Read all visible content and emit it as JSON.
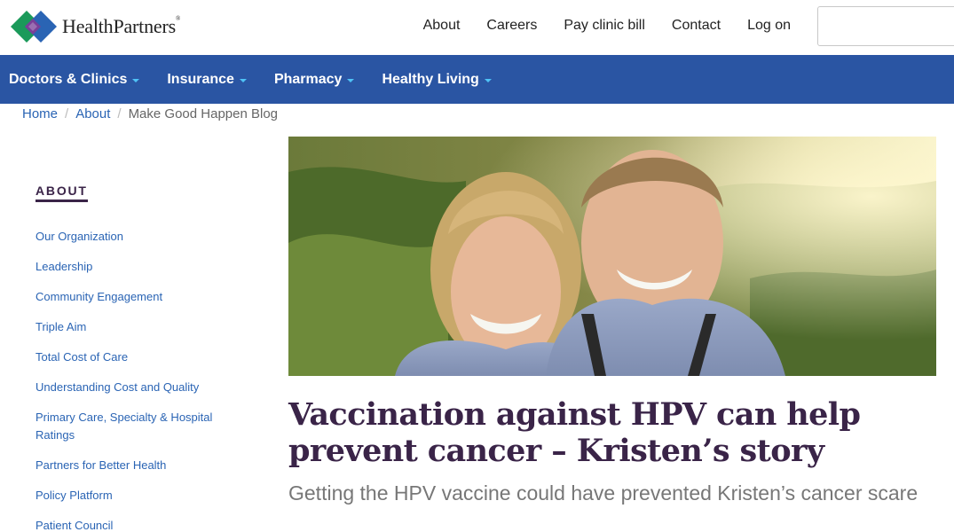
{
  "brand": {
    "name": "HealthPartners",
    "registered": "®",
    "logo_colors": [
      "#1b9a5a",
      "#2a64b4",
      "#7a3f98"
    ]
  },
  "utility_nav": [
    "About",
    "Careers",
    "Pay clinic bill",
    "Contact",
    "Log on"
  ],
  "search": {
    "placeholder": ""
  },
  "main_nav": [
    "Doctors & Clinics",
    "Insurance",
    "Pharmacy",
    "Healthy Living"
  ],
  "breadcrumb": {
    "home": "Home",
    "about": "About",
    "current": "Make Good Happen Blog"
  },
  "sidebar": {
    "title": "ABOUT",
    "items": [
      "Our Organization",
      "Leadership",
      "Community Engagement",
      "Triple Aim",
      "Total Cost of Care",
      "Understanding Cost and Quality",
      "Primary Care, Specialty & Hospital Ratings",
      "Partners for Better Health",
      "Policy Platform",
      "Patient Council"
    ]
  },
  "article": {
    "title": "Vaccination against HPV can help prevent cancer – Kristen’s story",
    "subtitle": "Getting the HPV vaccine could have prevented Kristen’s cancer scare"
  },
  "colors": {
    "nav_bg": "#2a55a3",
    "link": "#2a64b4",
    "title": "#3a2448",
    "caret": "#4fc3f7"
  }
}
